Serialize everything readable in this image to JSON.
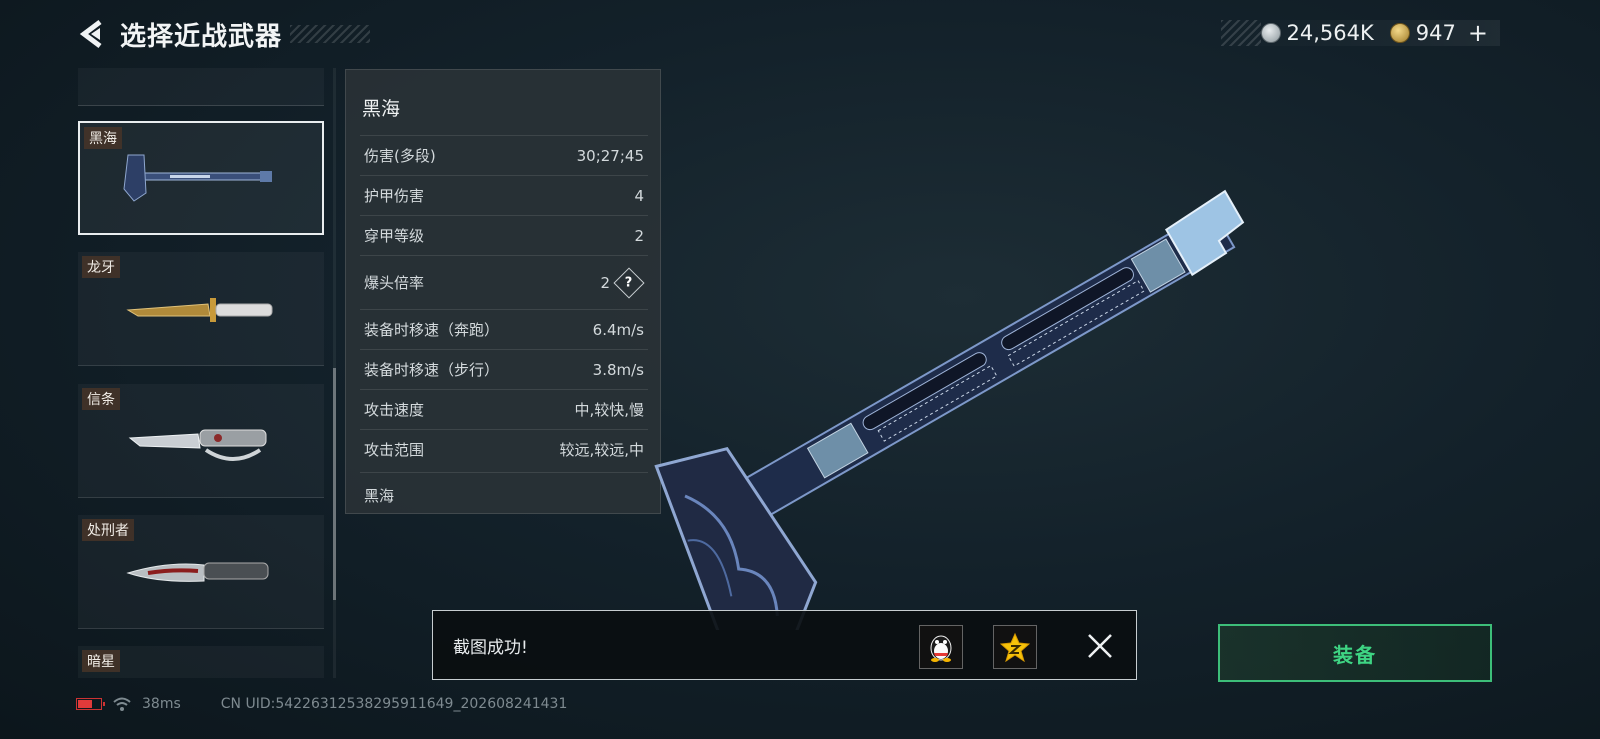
{
  "header": {
    "title": "选择近战武器",
    "back_icon": "chevron-left-icon"
  },
  "currency": {
    "silver_icon": "silver-coin-icon",
    "silver_value": "24,564K",
    "gold_icon": "gold-coin-icon",
    "gold_value": "947",
    "add_label": "+"
  },
  "weapon_list": {
    "items": [
      {
        "label": "黑海",
        "selected": true
      },
      {
        "label": "龙牙",
        "selected": false
      },
      {
        "label": "信条",
        "selected": false
      },
      {
        "label": "处刑者",
        "selected": false
      },
      {
        "label": "暗星",
        "selected": false
      }
    ]
  },
  "stats": {
    "name": "黑海",
    "rows": [
      {
        "key": "伤害(多段)",
        "value": "30;27;45"
      },
      {
        "key": "护甲伤害",
        "value": "4"
      },
      {
        "key": "穿甲等级",
        "value": "2"
      },
      {
        "key": "爆头倍率",
        "value": "2",
        "help": "?"
      },
      {
        "key": "装备时移速（奔跑）",
        "value": "6.4m/s"
      },
      {
        "key": "装备时移速（步行）",
        "value": "3.8m/s"
      },
      {
        "key": "攻击速度",
        "value": "中,较快,慢"
      },
      {
        "key": "攻击范围",
        "value": "较远,较远,中"
      }
    ],
    "footer": "黑海"
  },
  "toast": {
    "message": "截图成功!",
    "qq_icon": "qq-penguin-icon",
    "qzone_icon": "qzone-star-icon",
    "close_icon": "close-icon"
  },
  "equip_button": {
    "label": "装备",
    "color": "#3ed483"
  },
  "status_bar": {
    "latency": "38ms",
    "uid": "CN UID:5422631253829591164​9_202608241431"
  },
  "colors": {
    "accent_green": "#3dbe79",
    "battery_red": "#e03a3a"
  }
}
